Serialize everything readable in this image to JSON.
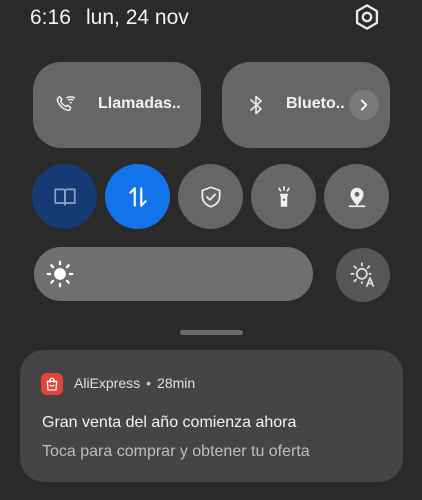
{
  "status_bar": {
    "time": "6:16",
    "date": "lun, 24 nov"
  },
  "quick_tiles": [
    {
      "label": "Llamadas..",
      "icon": "wifi-calling-icon"
    },
    {
      "label": "Blueto..",
      "icon": "bluetooth-icon"
    }
  ],
  "toggles": [
    {
      "icon": "reading-mode-icon",
      "color": "#153a74"
    },
    {
      "icon": "mobile-data-icon",
      "color": "#1273ea"
    },
    {
      "icon": "shield-icon",
      "color": "#666666"
    },
    {
      "icon": "flashlight-icon",
      "color": "#666666"
    },
    {
      "icon": "location-icon",
      "color": "#666666"
    }
  ],
  "brightness": {
    "icon": "sun-icon",
    "auto_icon": "auto-brightness-icon"
  },
  "notification": {
    "app_name": "AliExpress",
    "separator": "•",
    "time": "28min",
    "title": "Gran venta del año comienza ahora",
    "body": "Toca para comprar y obtener tu oferta",
    "app_color": "#e6433b"
  }
}
